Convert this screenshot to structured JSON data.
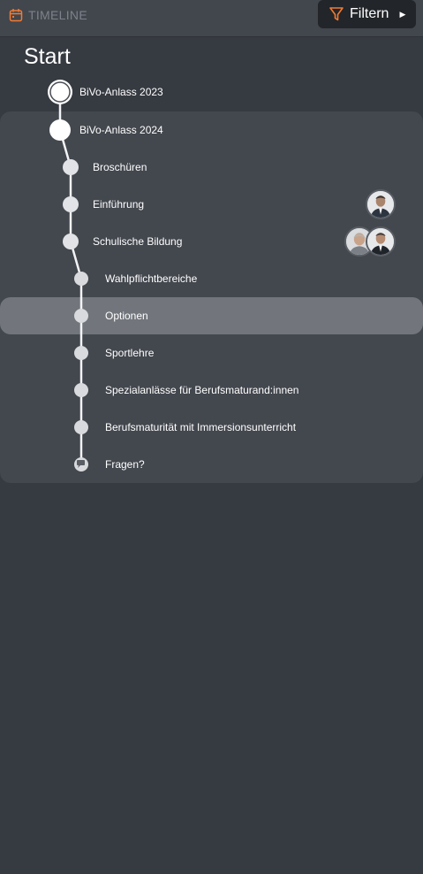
{
  "header": {
    "section_label": "TIMELINE",
    "section_icon": "calendar-icon",
    "filter_label": "Filtern",
    "filter_icon": "funnel-icon",
    "accent_color": "#f27b32"
  },
  "timeline": {
    "start_label": "Start",
    "events": [
      {
        "label": "BiVo-Anlass 2023"
      },
      {
        "label": "BiVo-Anlass 2024"
      }
    ],
    "items": [
      {
        "label": "Broschüren"
      },
      {
        "label": "Einführung"
      },
      {
        "label": "Schulische Bildung"
      },
      {
        "label": "Wahlpflichtbereiche"
      },
      {
        "label": "Optionen"
      },
      {
        "label": "Sportlehre"
      },
      {
        "label": "Spezialanlässe für Berufsmaturand:innen"
      },
      {
        "label": "Berufsmaturität mit Immersionsunterricht"
      },
      {
        "label": "Fragen?"
      }
    ],
    "active_item": "Optionen"
  }
}
